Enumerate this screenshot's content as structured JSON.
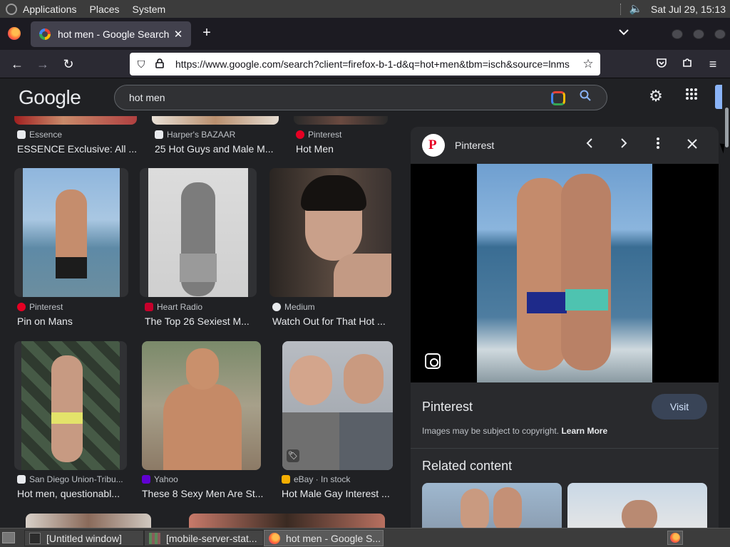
{
  "os_panel": {
    "menus": [
      "Applications",
      "Places",
      "System"
    ],
    "clock": "Sat Jul 29, 15:13"
  },
  "browser": {
    "tab_title": "hot men - Google Search",
    "tab_close": "✕",
    "new_tab": "+",
    "tab_list": "⌄",
    "url": "https://www.google.com/search?client=firefox-b-1-d&q=hot+men&tbm=isch&source=lnms"
  },
  "google": {
    "logo": "Google",
    "query": "hot men"
  },
  "results": [
    {
      "source": "Essence",
      "caption": "ESSENCE Exclusive: All ...",
      "icon_color": "#e8eaed"
    },
    {
      "source": "Harper's BAZAAR",
      "caption": "25 Hot Guys and Male M...",
      "icon_color": "#e8eaed"
    },
    {
      "source": "Pinterest",
      "caption": "Hot Men",
      "icon_color": "#e60023"
    },
    {
      "source": "Pinterest",
      "caption": "Pin on Mans",
      "icon_color": "#e60023"
    },
    {
      "source": "Heart Radio",
      "caption": "The Top 26 Sexiest M...",
      "icon_color": "#c6002b"
    },
    {
      "source": "Medium",
      "caption": "Watch Out for That Hot ...",
      "icon_color": "#e8eaed"
    },
    {
      "source": "San Diego Union-Tribu...",
      "caption": "Hot men, questionabl...",
      "icon_color": "#e8eaed"
    },
    {
      "source": "Yahoo",
      "caption": "These 8 Sexy Men Are St...",
      "icon_color": "#6001d2"
    },
    {
      "source": "eBay · In stock",
      "caption": "Hot Male Gay Interest ...",
      "icon_color": "#f5af02"
    }
  ],
  "panel": {
    "source_name": "Pinterest",
    "site": "Pinterest",
    "visit_label": "Visit",
    "copyright": "Images may be subject to copyright.",
    "learn_more": "Learn More",
    "related_title": "Related content"
  },
  "taskbar": {
    "items": [
      "[Untitled window]",
      "[mobile-server-stat...",
      "hot men - Google S..."
    ]
  },
  "colors": {
    "background": "#202124",
    "accent": "#8ab4f8",
    "pinterest": "#e60023"
  }
}
